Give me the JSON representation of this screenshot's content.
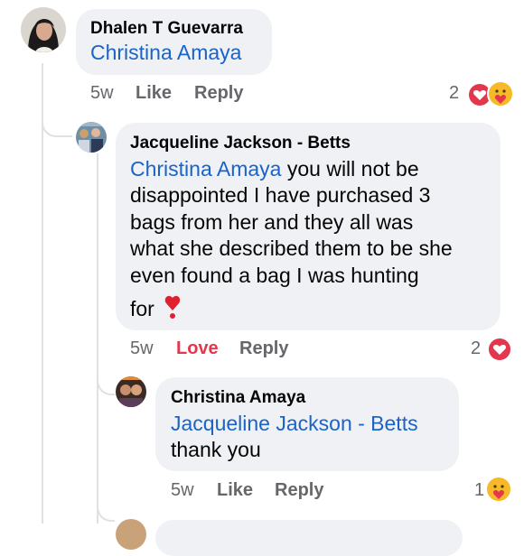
{
  "comments": [
    {
      "author": "Dhalen T Guevarra",
      "mention": "Christina Amaya",
      "text": "",
      "time": "5w",
      "primary_action": "Like",
      "reply_label": "Reply",
      "reaction_count": "2",
      "reactions": [
        "love-icon",
        "care-icon"
      ]
    },
    {
      "author": "Jacqueline Jackson - Betts",
      "mention": "Christina Amaya",
      "text_line1": " you will not be",
      "text_line2": "disappointed I have purchased 3",
      "text_line3": "bags from her and they all was",
      "text_line4": "what she described them to be she",
      "text_line5": "even found a bag I was hunting",
      "text_line6": "for",
      "time": "5w",
      "primary_action": "Love",
      "reply_label": "Reply",
      "reaction_count": "2",
      "reactions": [
        "love-icon"
      ],
      "colors": {
        "love": "#e4364c"
      }
    },
    {
      "author": "Christina Amaya",
      "mention": "Jacqueline Jackson - Betts",
      "text": "thank you",
      "time": "5w",
      "primary_action": "Like",
      "reply_label": "Reply",
      "reaction_count": "1",
      "reactions": [
        "care-icon"
      ]
    }
  ],
  "colors": {
    "mention": "#1a63c7",
    "bubble": "#eff1f4",
    "love": "#e4364c",
    "meta": "#65676b"
  }
}
